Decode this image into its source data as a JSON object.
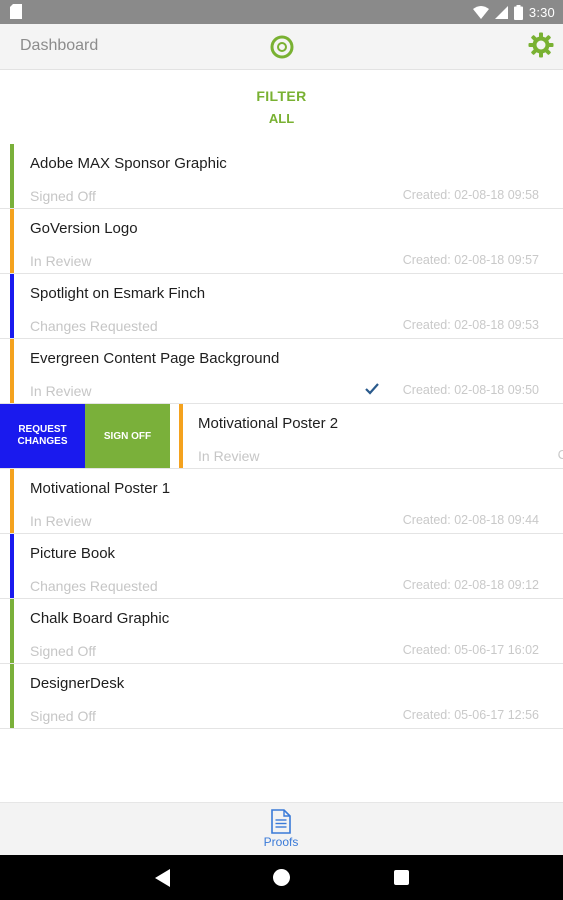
{
  "status_bar": {
    "time": "3:30"
  },
  "header": {
    "title": "Dashboard"
  },
  "filter": {
    "label": "FILTER",
    "value": "ALL"
  },
  "colors": {
    "signed_off": "#7ab03a",
    "in_review": "#f4a21e",
    "changes_requested": "#1a1aee",
    "accent": "#79b132",
    "tab_active": "#3a7ad8"
  },
  "proofs": [
    {
      "title": "Adobe MAX Sponsor Graphic",
      "status": "Signed Off",
      "created": "Created: 02-08-18 09:58"
    },
    {
      "title": "GoVersion Logo",
      "status": "In Review",
      "created": "Created: 02-08-18 09:57"
    },
    {
      "title": "Spotlight on Esmark Finch",
      "status": "Changes Requested",
      "created": "Created: 02-08-18 09:53"
    },
    {
      "title": "Evergreen Content Page Background",
      "status": "In Review",
      "created": "Created: 02-08-18 09:50"
    },
    {
      "title": "Motivational Poster 2",
      "status": "In Review",
      "created": "C"
    },
    {
      "title": "Motivational Poster 1",
      "status": "In Review",
      "created": "Created: 02-08-18 09:44"
    },
    {
      "title": "Picture Book",
      "status": "Changes Requested",
      "created": "Created: 02-08-18 09:12"
    },
    {
      "title": "Chalk Board Graphic",
      "status": "Signed Off",
      "created": "Created: 05-06-17 16:02"
    },
    {
      "title": "DesignerDesk",
      "status": "Signed Off",
      "created": "Created: 05-06-17 12:56"
    }
  ],
  "swipe_actions": {
    "request_changes": "REQUEST\nCHANGES",
    "sign_off": "SIGN OFF"
  },
  "bottom_tabs": {
    "proofs_label": "Proofs"
  },
  "icons": {
    "logo": "circle-logo-icon",
    "settings": "gear-icon",
    "proofs": "document-icon",
    "check": "checkmark-icon"
  }
}
